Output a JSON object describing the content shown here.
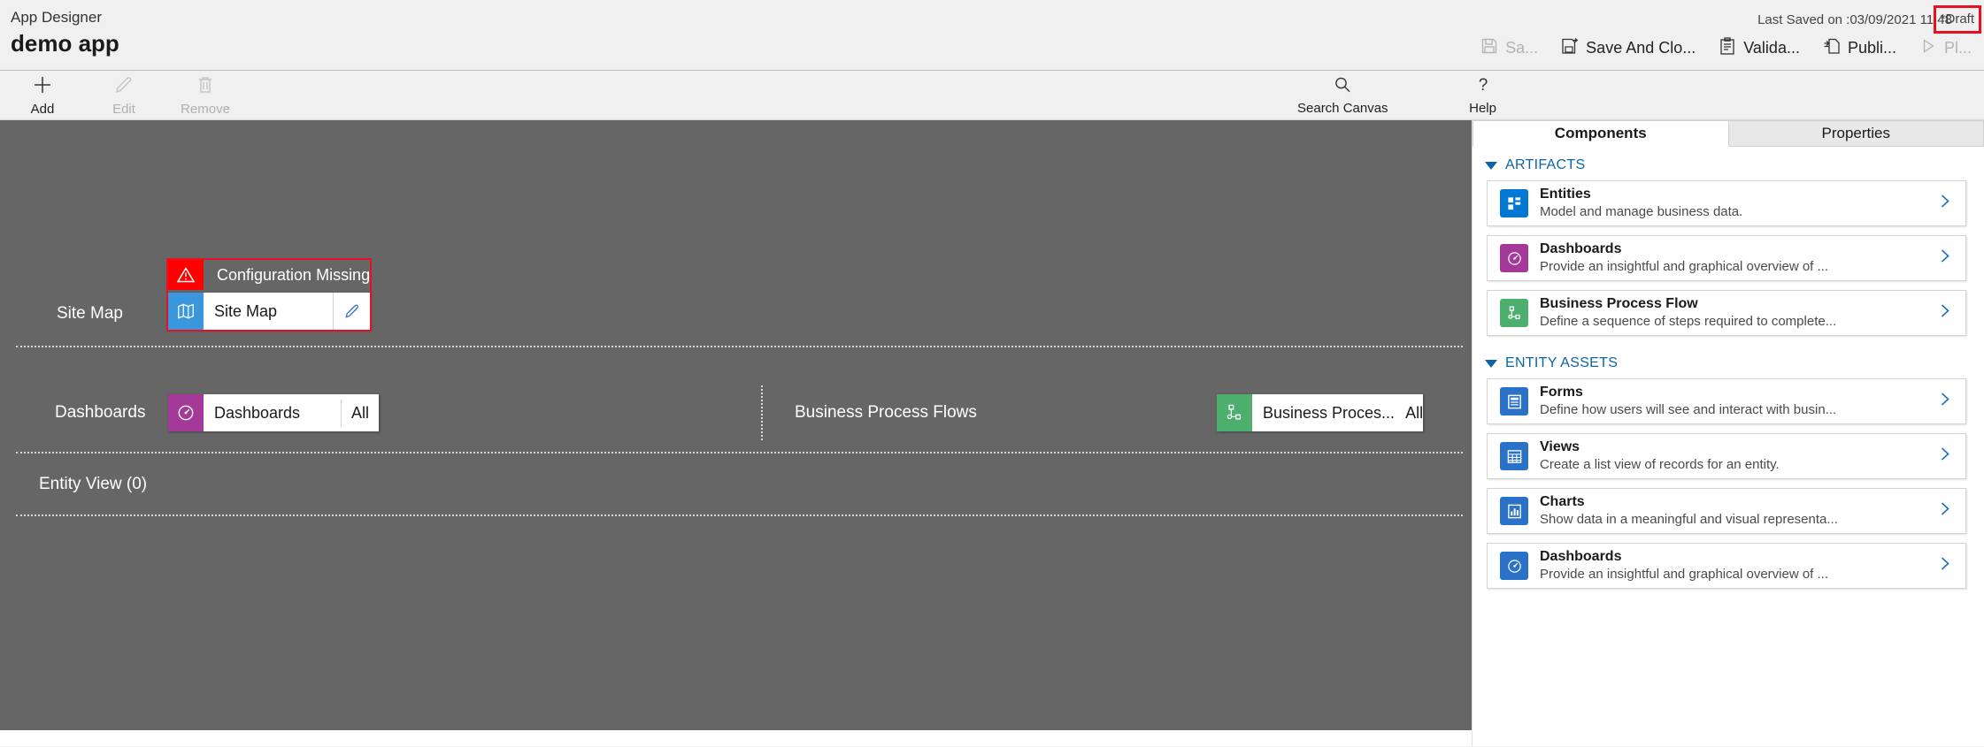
{
  "header": {
    "app_label": "App Designer",
    "app_title": "demo app",
    "last_saved": "Last Saved on :03/09/2021 11:48",
    "draft_status": "*Draft",
    "actions": [
      {
        "label": "Sa...",
        "icon": "save-icon",
        "disabled": true
      },
      {
        "label": "Save And Clo...",
        "icon": "save-and-close-icon",
        "disabled": false
      },
      {
        "label": "Valida...",
        "icon": "validate-icon",
        "disabled": false
      },
      {
        "label": "Publi...",
        "icon": "publish-icon",
        "disabled": false
      },
      {
        "label": "Pl...",
        "icon": "play-icon",
        "disabled": true
      }
    ]
  },
  "command_bar": {
    "left": [
      {
        "label": "Add",
        "icon": "plus-icon",
        "disabled": false
      },
      {
        "label": "Edit",
        "icon": "pencil-icon",
        "disabled": true
      },
      {
        "label": "Remove",
        "icon": "trash-icon",
        "disabled": true
      }
    ],
    "right": [
      {
        "label": "Search Canvas",
        "icon": "search-icon",
        "disabled": false
      },
      {
        "label": "Help",
        "icon": "question-icon",
        "disabled": false
      }
    ]
  },
  "canvas": {
    "rows": [
      {
        "label": "Site Map",
        "warning": {
          "text": "Configuration Missing",
          "icon": "warning-icon"
        },
        "tile": {
          "name": "Site Map",
          "icon": "sitemap-icon",
          "edit_icon": "pencil-icon",
          "selected": true
        }
      },
      {
        "label": "Dashboards",
        "tile": {
          "name": "Dashboards",
          "icon": "dashboard-icon",
          "all_label": "All"
        },
        "secondary_label": "Business Process Flows",
        "secondary_tile": {
          "name": "Business Proces...",
          "icon": "bpf-icon",
          "all_label": "All"
        }
      },
      {
        "label": "Entity View (0)"
      }
    ]
  },
  "panel": {
    "tabs": [
      {
        "label": "Components",
        "active": true
      },
      {
        "label": "Properties",
        "active": false
      }
    ],
    "groups": [
      {
        "title": "ARTIFACTS",
        "items": [
          {
            "title": "Entities",
            "desc": "Model and manage business data.",
            "icon": "entities-icon",
            "color": "#0078d4",
            "chevron": "chevron-right-icon"
          },
          {
            "title": "Dashboards",
            "desc": "Provide an insightful and graphical overview of ...",
            "icon": "dashboard-icon",
            "color": "#a4399a",
            "chevron": "chevron-right-icon"
          },
          {
            "title": "Business Process Flow",
            "desc": "Define a sequence of steps required to complete...",
            "icon": "bpf-icon",
            "color": "#4caf6e",
            "chevron": "chevron-right-icon"
          }
        ]
      },
      {
        "title": "ENTITY ASSETS",
        "items": [
          {
            "title": "Forms",
            "desc": "Define how users will see and interact with busin...",
            "icon": "forms-icon",
            "color": "#2a72c9",
            "chevron": "chevron-right-icon"
          },
          {
            "title": "Views",
            "desc": "Create a list view of records for an entity.",
            "icon": "views-icon",
            "color": "#2a72c9",
            "chevron": "chevron-right-icon"
          },
          {
            "title": "Charts",
            "desc": "Show data in a meaningful and visual representa...",
            "icon": "charts-icon",
            "color": "#2a72c9",
            "chevron": "chevron-right-icon"
          },
          {
            "title": "Dashboards",
            "desc": "Provide an insightful and graphical overview of ...",
            "icon": "dashboard-icon",
            "color": "#2a72c9",
            "chevron": "chevron-right-icon"
          }
        ]
      }
    ]
  },
  "colors": {
    "canvas_bg": "#666666",
    "warning_red": "#ff0000",
    "highlight_red": "#e81123",
    "accent_blue": "#0b64a5"
  }
}
